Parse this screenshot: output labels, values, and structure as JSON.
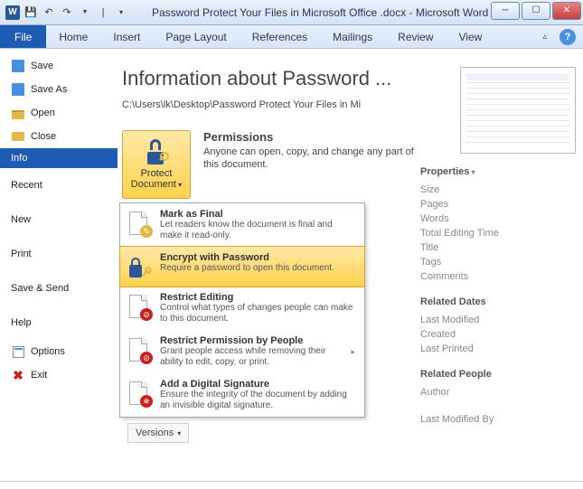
{
  "window": {
    "title": "Password Protect Your Files in Microsoft Office .docx - Microsoft Word"
  },
  "ribbon": {
    "file": "File",
    "tabs": [
      "Home",
      "Insert",
      "Page Layout",
      "References",
      "Mailings",
      "Review",
      "View"
    ]
  },
  "backstage_nav": {
    "save": "Save",
    "save_as": "Save As",
    "open": "Open",
    "close": "Close",
    "info": "Info",
    "recent": "Recent",
    "new": "New",
    "print": "Print",
    "save_send": "Save & Send",
    "help": "Help",
    "options": "Options",
    "exit": "Exit"
  },
  "info": {
    "title": "Information about Password ...",
    "path": "C:\\Users\\lk\\Desktop\\Password Protect Your Files in Mi",
    "protect_button": "Protect Document",
    "permissions_title": "Permissions",
    "permissions_body": "Anyone can open, copy, and change any part of this document."
  },
  "protect_menu": [
    {
      "title": "Mark as Final",
      "desc": "Let readers know the document is final and make it read-only."
    },
    {
      "title": "Encrypt with Password",
      "desc": "Require a password to open this document."
    },
    {
      "title": "Restrict Editing",
      "desc": "Control what types of changes people can make to this document."
    },
    {
      "title": "Restrict Permission by People",
      "desc": "Grant people access while removing their ability to edit, copy, or print."
    },
    {
      "title": "Add a Digital Signature",
      "desc": "Ensure the integrity of the document by adding an invisible digital signature."
    }
  ],
  "versions_button": "Versions",
  "side": {
    "properties": "Properties",
    "props": [
      "Size",
      "Pages",
      "Words",
      "Total Editing Time",
      "Title",
      "Tags",
      "Comments"
    ],
    "related_dates": "Related Dates",
    "dates": [
      "Last Modified",
      "Created",
      "Last Printed"
    ],
    "related_people": "Related People",
    "people": [
      "Author",
      "Last Modified By"
    ]
  }
}
